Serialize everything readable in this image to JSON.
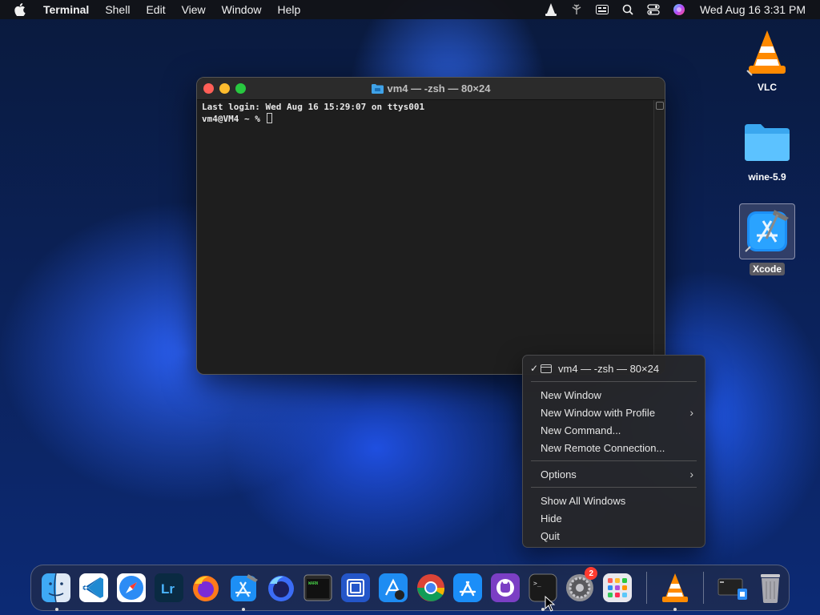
{
  "menubar": {
    "app_name": "Terminal",
    "items": [
      "Shell",
      "Edit",
      "View",
      "Window",
      "Help"
    ],
    "clock": "Wed Aug 16  3:31 PM"
  },
  "terminal": {
    "title": "vm4 — -zsh — 80×24",
    "lines": [
      "Last login: Wed Aug 16 15:29:07 on ttys001",
      "vm4@VM4 ~ % "
    ]
  },
  "desktop": {
    "icons": [
      {
        "label": "VLC",
        "icon": "vlc-cone-icon"
      },
      {
        "label": "wine-5.9",
        "icon": "folder-icon"
      },
      {
        "label": "Xcode",
        "icon": "xcode-icon"
      }
    ]
  },
  "context_menu": {
    "current_window": "vm4 — -zsh — 80×24",
    "new_window": "New Window",
    "new_window_profile": "New Window with Profile",
    "new_command": "New Command...",
    "new_remote": "New Remote Connection...",
    "options": "Options",
    "show_all": "Show All Windows",
    "hide": "Hide",
    "quit": "Quit"
  },
  "dock": {
    "apps": [
      "Finder",
      "Visual Studio Code",
      "Safari",
      "Lightroom",
      "Firefox",
      "Xcode",
      "Firefox Developer Edition",
      "Console",
      "Simulator",
      "Instruments",
      "Chrome",
      "App Store",
      "GitHub Desktop",
      "Terminal",
      "System Settings",
      "Launchpad",
      "VLC",
      "Downloads",
      "Trash"
    ],
    "settings_badge": "2"
  },
  "colors": {
    "close": "#ff5f57",
    "minimize": "#febc2e",
    "maximize": "#28c840",
    "badge": "#ff3b30"
  }
}
